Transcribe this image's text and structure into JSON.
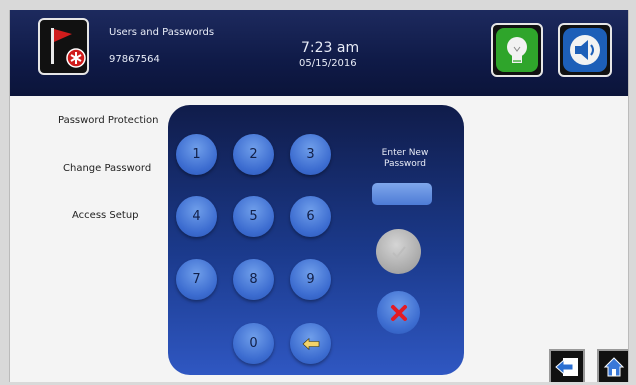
{
  "header": {
    "title": "Users and Passwords",
    "device_id": "97867564",
    "time": "7:23 am",
    "date": "05/15/2016"
  },
  "sidebar": {
    "items": [
      {
        "label": "Password Protection"
      },
      {
        "label": "Change Password"
      },
      {
        "label": "Access Setup"
      }
    ]
  },
  "keypad": {
    "keys": [
      "1",
      "2",
      "3",
      "4",
      "5",
      "6",
      "7",
      "8",
      "9",
      "0"
    ],
    "enter_label": "Enter New Password",
    "password_value": ""
  },
  "icons": {
    "flag": "flag-icon",
    "bulb": "light-bulb-icon",
    "sound": "speaker-icon",
    "back": "back-arrow-icon",
    "home": "home-icon",
    "confirm": "check-icon",
    "cancel": "x-icon",
    "backspace": "backspace-arrow-icon"
  },
  "colors": {
    "header_bg": "#0f1a47",
    "key_blue": "#3c6cd0",
    "cancel_red": "#e31b23",
    "bulb_green": "#2fa52b",
    "sound_blue": "#1d5fb8"
  }
}
